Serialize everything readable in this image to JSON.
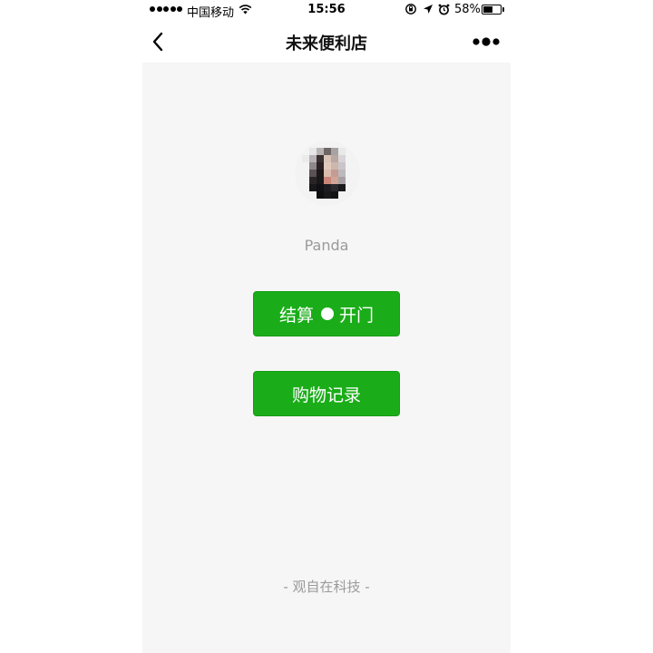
{
  "status_bar": {
    "carrier": "中国移动",
    "time": "15:56",
    "battery_percent": "58%",
    "battery_level": 0.58
  },
  "nav": {
    "title": "未来便利店"
  },
  "profile": {
    "name": "Panda"
  },
  "buttons": {
    "checkout_label_left": "结算",
    "checkout_label_right": "开门",
    "history_label": "购物记录"
  },
  "footer": {
    "text": "- 观自在科技 -"
  },
  "colors": {
    "primary_green": "#1aad19",
    "background": "#f6f6f6",
    "muted_text": "#9a9a9a"
  }
}
